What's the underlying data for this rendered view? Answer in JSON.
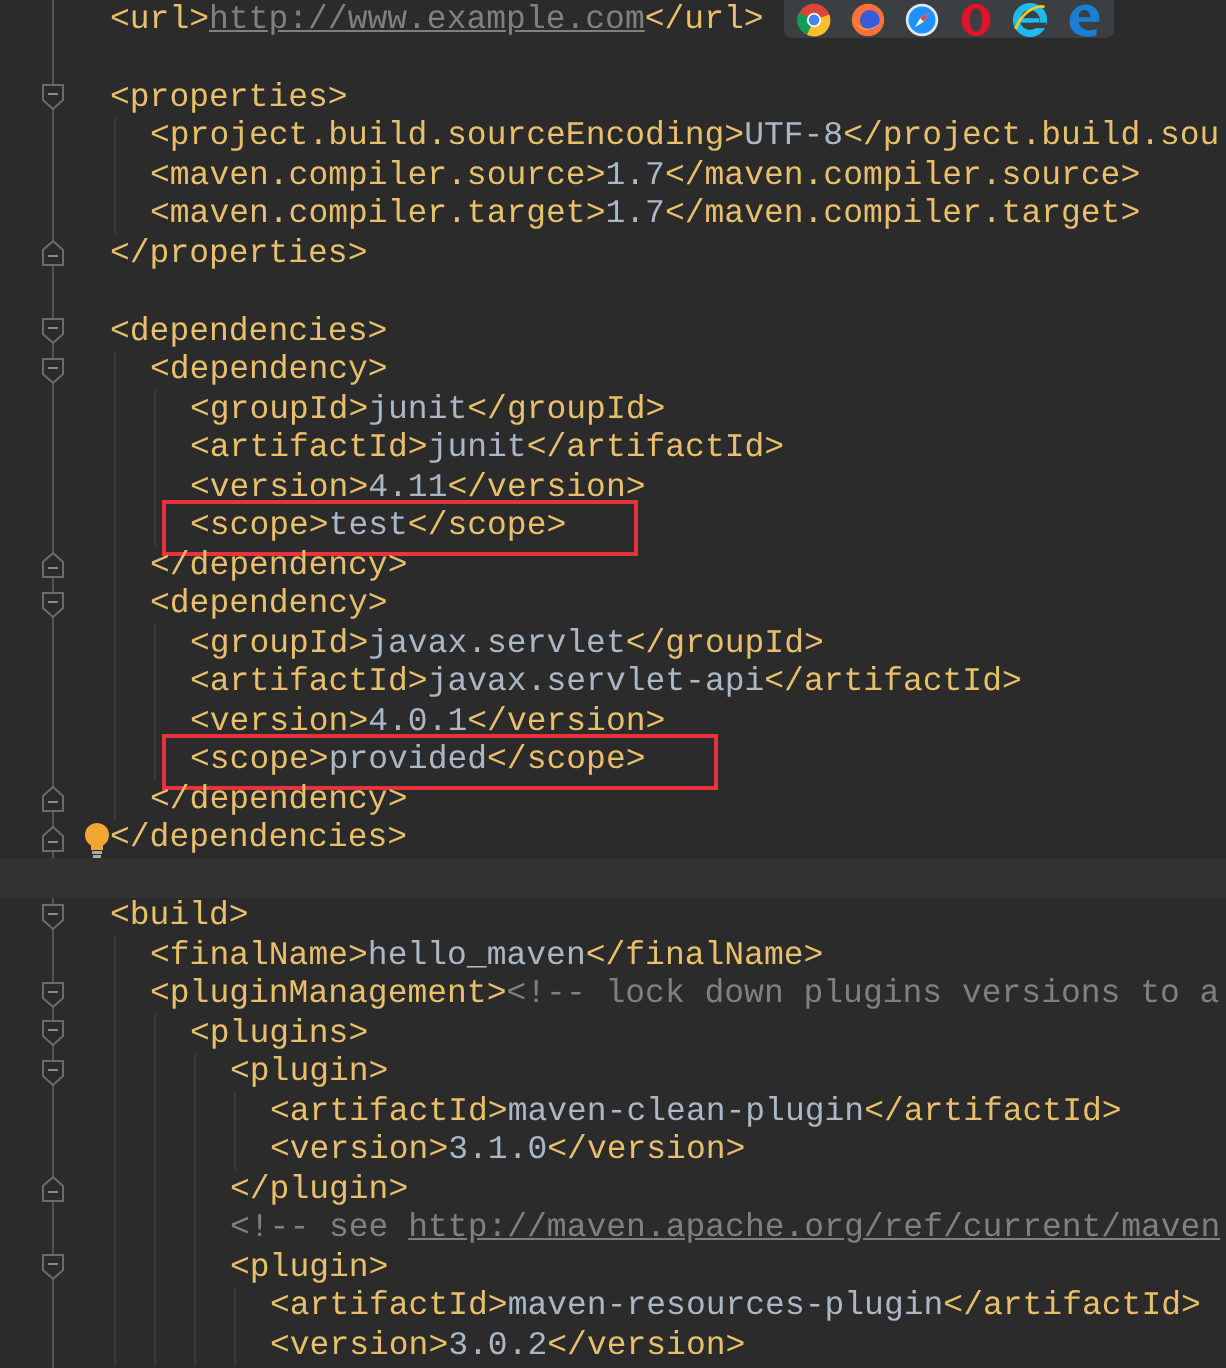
{
  "browser_icons": [
    {
      "kind": "chrome"
    },
    {
      "kind": "firefox"
    },
    {
      "kind": "safari"
    },
    {
      "kind": "opera"
    },
    {
      "kind": "ie"
    },
    {
      "kind": "edge"
    }
  ],
  "lines": [
    {
      "kind": "code",
      "segments": [
        {
          "kind": "tag",
          "text": "<url>"
        },
        {
          "kind": "link",
          "text": "http://www.example.com"
        },
        {
          "kind": "tag",
          "text": "</url>"
        }
      ]
    },
    {
      "kind": "blank"
    },
    {
      "kind": "code",
      "fold_marker": true,
      "segments": [
        {
          "kind": "tag",
          "text": "<properties>"
        }
      ],
      "children": [
        {
          "kind": "code",
          "segments": [
            {
              "kind": "tag",
              "text": "<project.build.sourceEncoding>"
            },
            {
              "kind": "text",
              "text": "UTF-8"
            },
            {
              "kind": "tag",
              "text": "</project.build.sou"
            }
          ]
        },
        {
          "kind": "code",
          "segments": [
            {
              "kind": "tag",
              "text": "<maven.compiler.source>"
            },
            {
              "kind": "text",
              "text": "1.7"
            },
            {
              "kind": "tag",
              "text": "</maven.compiler.source>"
            }
          ]
        },
        {
          "kind": "code",
          "segments": [
            {
              "kind": "tag",
              "text": "<maven.compiler.target>"
            },
            {
              "kind": "text",
              "text": "1.7"
            },
            {
              "kind": "tag",
              "text": "</maven.compiler.target>"
            }
          ]
        }
      ]
    },
    {
      "kind": "code",
      "fold_marker": true,
      "segments": [
        {
          "kind": "tag",
          "text": "</properties>"
        }
      ]
    },
    {
      "kind": "blank"
    },
    {
      "kind": "code",
      "fold_marker": true,
      "segments": [
        {
          "kind": "tag",
          "text": "<dependencies>"
        }
      ],
      "children": [
        {
          "kind": "code",
          "fold_marker": true,
          "segments": [
            {
              "kind": "tag",
              "text": "<dependency>"
            }
          ],
          "children": [
            {
              "kind": "code",
              "segments": [
                {
                  "kind": "tag",
                  "text": "<groupId>"
                },
                {
                  "kind": "text",
                  "text": "junit"
                },
                {
                  "kind": "tag",
                  "text": "</groupId>"
                }
              ]
            },
            {
              "kind": "code",
              "segments": [
                {
                  "kind": "tag",
                  "text": "<artifactId>"
                },
                {
                  "kind": "text",
                  "text": "junit"
                },
                {
                  "kind": "tag",
                  "text": "</artifactId>"
                }
              ]
            },
            {
              "kind": "code",
              "segments": [
                {
                  "kind": "tag",
                  "text": "<version>"
                },
                {
                  "kind": "text",
                  "text": "4.11"
                },
                {
                  "kind": "tag",
                  "text": "</version>"
                }
              ]
            },
            {
              "kind": "code",
              "boxed": true,
              "segments": [
                {
                  "kind": "tag",
                  "text": "<scope>"
                },
                {
                  "kind": "text",
                  "text": "test"
                },
                {
                  "kind": "tag",
                  "text": "</scope>"
                }
              ]
            }
          ]
        },
        {
          "kind": "code",
          "fold_marker": true,
          "segments": [
            {
              "kind": "tag",
              "text": "</dependency>"
            }
          ]
        },
        {
          "kind": "code",
          "fold_marker": true,
          "segments": [
            {
              "kind": "tag",
              "text": "<dependency>"
            }
          ],
          "children": [
            {
              "kind": "code",
              "segments": [
                {
                  "kind": "tag",
                  "text": "<groupId>"
                },
                {
                  "kind": "text",
                  "text": "javax.servlet"
                },
                {
                  "kind": "tag",
                  "text": "</groupId>"
                }
              ]
            },
            {
              "kind": "code",
              "segments": [
                {
                  "kind": "tag",
                  "text": "<artifactId>"
                },
                {
                  "kind": "text",
                  "text": "javax.servlet-api"
                },
                {
                  "kind": "tag",
                  "text": "</artifactId>"
                }
              ]
            },
            {
              "kind": "code",
              "segments": [
                {
                  "kind": "tag",
                  "text": "<version>"
                },
                {
                  "kind": "text",
                  "text": "4.0.1"
                },
                {
                  "kind": "tag",
                  "text": "</version>"
                }
              ]
            },
            {
              "kind": "code",
              "boxed": true,
              "segments": [
                {
                  "kind": "tag",
                  "text": "<scope>"
                },
                {
                  "kind": "text",
                  "text": "provided"
                },
                {
                  "kind": "tag",
                  "text": "</scope>"
                }
              ]
            }
          ]
        },
        {
          "kind": "code",
          "fold_marker": true,
          "segments": [
            {
              "kind": "tag",
              "text": "</dependency>"
            }
          ]
        }
      ]
    },
    {
      "kind": "code",
      "fold_marker": true,
      "bulb": true,
      "segments": [
        {
          "kind": "tag",
          "text": "</dependencies>"
        }
      ]
    },
    {
      "kind": "blank",
      "current": true
    },
    {
      "kind": "code",
      "fold_marker": true,
      "segments": [
        {
          "kind": "tag",
          "text": "<build>"
        }
      ],
      "children": [
        {
          "kind": "code",
          "segments": [
            {
              "kind": "tag",
              "text": "<finalName>"
            },
            {
              "kind": "text",
              "text": "hello_maven"
            },
            {
              "kind": "tag",
              "text": "</finalName>"
            }
          ]
        },
        {
          "kind": "code",
          "fold_marker": true,
          "segments": [
            {
              "kind": "tag",
              "text": "<pluginManagement>"
            },
            {
              "kind": "comment",
              "text": "<!-- lock down plugins versions to a"
            }
          ],
          "children": [
            {
              "kind": "code",
              "fold_marker": true,
              "segments": [
                {
                  "kind": "tag",
                  "text": "<plugins>"
                }
              ],
              "children": [
                {
                  "kind": "code",
                  "fold_marker": true,
                  "segments": [
                    {
                      "kind": "tag",
                      "text": "<plugin>"
                    }
                  ],
                  "children": [
                    {
                      "kind": "code",
                      "segments": [
                        {
                          "kind": "tag",
                          "text": "<artifactId>"
                        },
                        {
                          "kind": "text",
                          "text": "maven-clean-plugin"
                        },
                        {
                          "kind": "tag",
                          "text": "</artifactId>"
                        }
                      ]
                    },
                    {
                      "kind": "code",
                      "segments": [
                        {
                          "kind": "tag",
                          "text": "<version>"
                        },
                        {
                          "kind": "text",
                          "text": "3.1.0"
                        },
                        {
                          "kind": "tag",
                          "text": "</version>"
                        }
                      ]
                    }
                  ]
                },
                {
                  "kind": "code",
                  "fold_marker": true,
                  "segments": [
                    {
                      "kind": "tag",
                      "text": "</plugin>"
                    }
                  ]
                },
                {
                  "kind": "code",
                  "segments": [
                    {
                      "kind": "comment",
                      "text": "<!-- see "
                    },
                    {
                      "kind": "link",
                      "text": "http://maven.apache.org/ref/current/maven"
                    }
                  ]
                },
                {
                  "kind": "code",
                  "fold_marker": true,
                  "segments": [
                    {
                      "kind": "tag",
                      "text": "<plugin>"
                    }
                  ],
                  "children": [
                    {
                      "kind": "code",
                      "segments": [
                        {
                          "kind": "tag",
                          "text": "<artifactId>"
                        },
                        {
                          "kind": "text",
                          "text": "maven-resources-plugin"
                        },
                        {
                          "kind": "tag",
                          "text": "</artifactId>"
                        }
                      ]
                    },
                    {
                      "kind": "code",
                      "segments": [
                        {
                          "kind": "tag",
                          "text": "<version>"
                        },
                        {
                          "kind": "text",
                          "text": "3.0.2"
                        },
                        {
                          "kind": "tag",
                          "text": "</version>"
                        }
                      ]
                    }
                  ]
                }
              ]
            }
          ]
        }
      ]
    }
  ]
}
